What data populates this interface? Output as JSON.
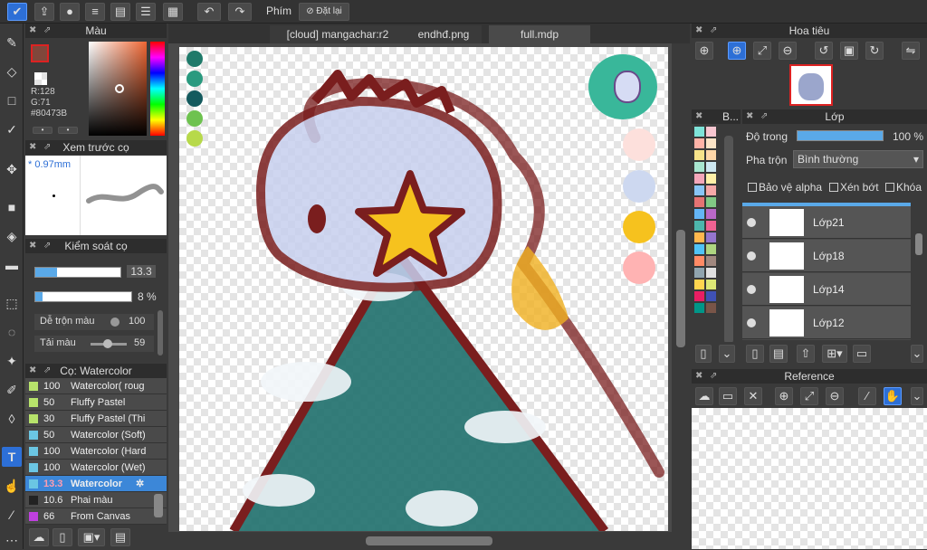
{
  "toolbar": {
    "shortcut_label": "Phím",
    "reset_label": "Đặt lại"
  },
  "tabs": [
    {
      "label": "[cloud] mangachar:r2"
    },
    {
      "label": "endhđ.png"
    },
    {
      "label": "full.mdp"
    }
  ],
  "color_panel": {
    "title": "Màu",
    "r": "R:128",
    "g": "G:71",
    "hex": "#80473B",
    "current_color": "#80473B"
  },
  "brush_preview": {
    "title": "Xem trước cọ",
    "size": "* 0.97mm"
  },
  "brush_control": {
    "title": "Kiểm soát cọ",
    "size_value": "13.3",
    "opacity_value": "8 %",
    "blend_label": "Dễ trộn màu",
    "blend_value": "100",
    "load_label": "Tải màu",
    "load_value": "59",
    "size_fill": 0.25,
    "opacity_fill": 0.08
  },
  "brushes": {
    "title": "Cọ: Watercolor",
    "items": [
      {
        "size": "100",
        "name": "Watercolor( roug",
        "color": "#b7e36b"
      },
      {
        "size": "50",
        "name": "Fluffy Pastel",
        "color": "#b7e36b"
      },
      {
        "size": "30",
        "name": "Fluffy Pastel (Thi",
        "color": "#b7e36b"
      },
      {
        "size": "50",
        "name": "Watercolor (Soft)",
        "color": "#6bc6e3"
      },
      {
        "size": "100",
        "name": "Watercolor (Hard",
        "color": "#6bc6e3"
      },
      {
        "size": "100",
        "name": "Watercolor (Wet)",
        "color": "#6bc6e3"
      },
      {
        "size": "13.3",
        "name": "Watercolor",
        "color": "#6bc6e3"
      },
      {
        "size": "10.6",
        "name": "Phai màu",
        "color": "#222222"
      },
      {
        "size": "66",
        "name": "From Canvas",
        "color": "#c040e0"
      }
    ]
  },
  "navigator": {
    "title": "Hoa tiêu"
  },
  "layers": {
    "title": "Lớp",
    "palette_title": "B...",
    "opacity_label": "Độ trong",
    "opacity_value": "100 %",
    "blend_label": "Pha trộn",
    "blend_value": "Bình thường",
    "protect_alpha": "Bảo vệ alpha",
    "clip": "Xén bớt",
    "lock": "Khóa",
    "items": [
      {
        "name": "Lớp21"
      },
      {
        "name": "Lớp18"
      },
      {
        "name": "Lớp14"
      },
      {
        "name": "Lớp12"
      }
    ]
  },
  "reference": {
    "title": "Reference"
  },
  "canvas_swatches": {
    "left": [
      "#1f7a6a",
      "#2a9a7f",
      "#145a5e",
      "#6ec24f",
      "#b7d94a"
    ],
    "right": [
      "#fde0dc",
      "#cdd8f0",
      "#f6c21e",
      "#ffb3b3"
    ]
  }
}
